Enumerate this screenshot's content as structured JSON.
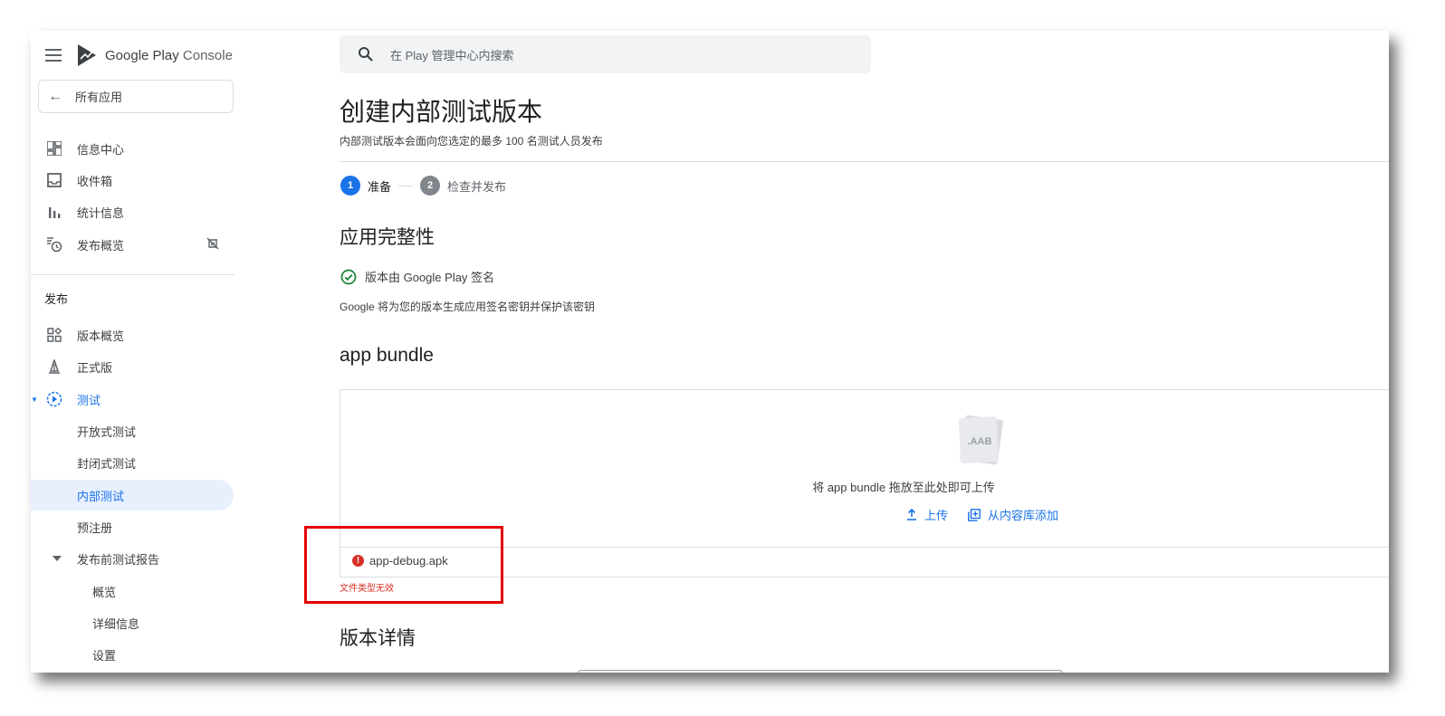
{
  "brand": {
    "name_part1": "Google Play",
    "name_part2": "Console"
  },
  "sidebar": {
    "all_apps": "所有应用",
    "top_items": [
      {
        "label": "信息中心",
        "icon": "dashboard-icon"
      },
      {
        "label": "收件箱",
        "icon": "inbox-icon"
      },
      {
        "label": "统计信息",
        "icon": "bar-chart-icon"
      },
      {
        "label": "发布概览",
        "icon": "publishing-overview-icon"
      }
    ],
    "section_label": "发布",
    "release_items": [
      {
        "label": "版本概览",
        "icon": "releases-overview-icon"
      },
      {
        "label": "正式版",
        "icon": "production-icon"
      },
      {
        "label": "测试",
        "icon": "testing-icon"
      },
      {
        "label": "开放式测试"
      },
      {
        "label": "封闭式测试"
      },
      {
        "label": "内部测试"
      },
      {
        "label": "预注册"
      },
      {
        "label": "发布前测试报告"
      },
      {
        "label": "概览"
      },
      {
        "label": "详细信息"
      },
      {
        "label": "设置"
      }
    ]
  },
  "search": {
    "placeholder": "在 Play 管理中心内搜索"
  },
  "main": {
    "title": "创建内部测试版本",
    "subtitle": "内部测试版本会面向您选定的最多 100 名测试人员发布",
    "steps": [
      {
        "num": "1",
        "label": "准备"
      },
      {
        "num": "2",
        "label": "检查并发布"
      }
    ],
    "integrity": {
      "heading": "应用完整性",
      "signed_label": "版本由 Google Play 签名",
      "description": "Google 将为您的版本生成应用签名密钥并保护该密钥"
    },
    "bundle": {
      "heading": "app bundle",
      "aab_label": ".AAB",
      "drop_text": "将 app bundle 拖放至此处即可上传",
      "upload_label": "上传",
      "library_label": "从内容库添加",
      "file_name": "app-debug.apk",
      "error_text": "文件类型无效"
    },
    "details_heading": "版本详情"
  },
  "colors": {
    "accent": "#1a73e8",
    "error": "#d93025",
    "highlight": "#e50000"
  }
}
